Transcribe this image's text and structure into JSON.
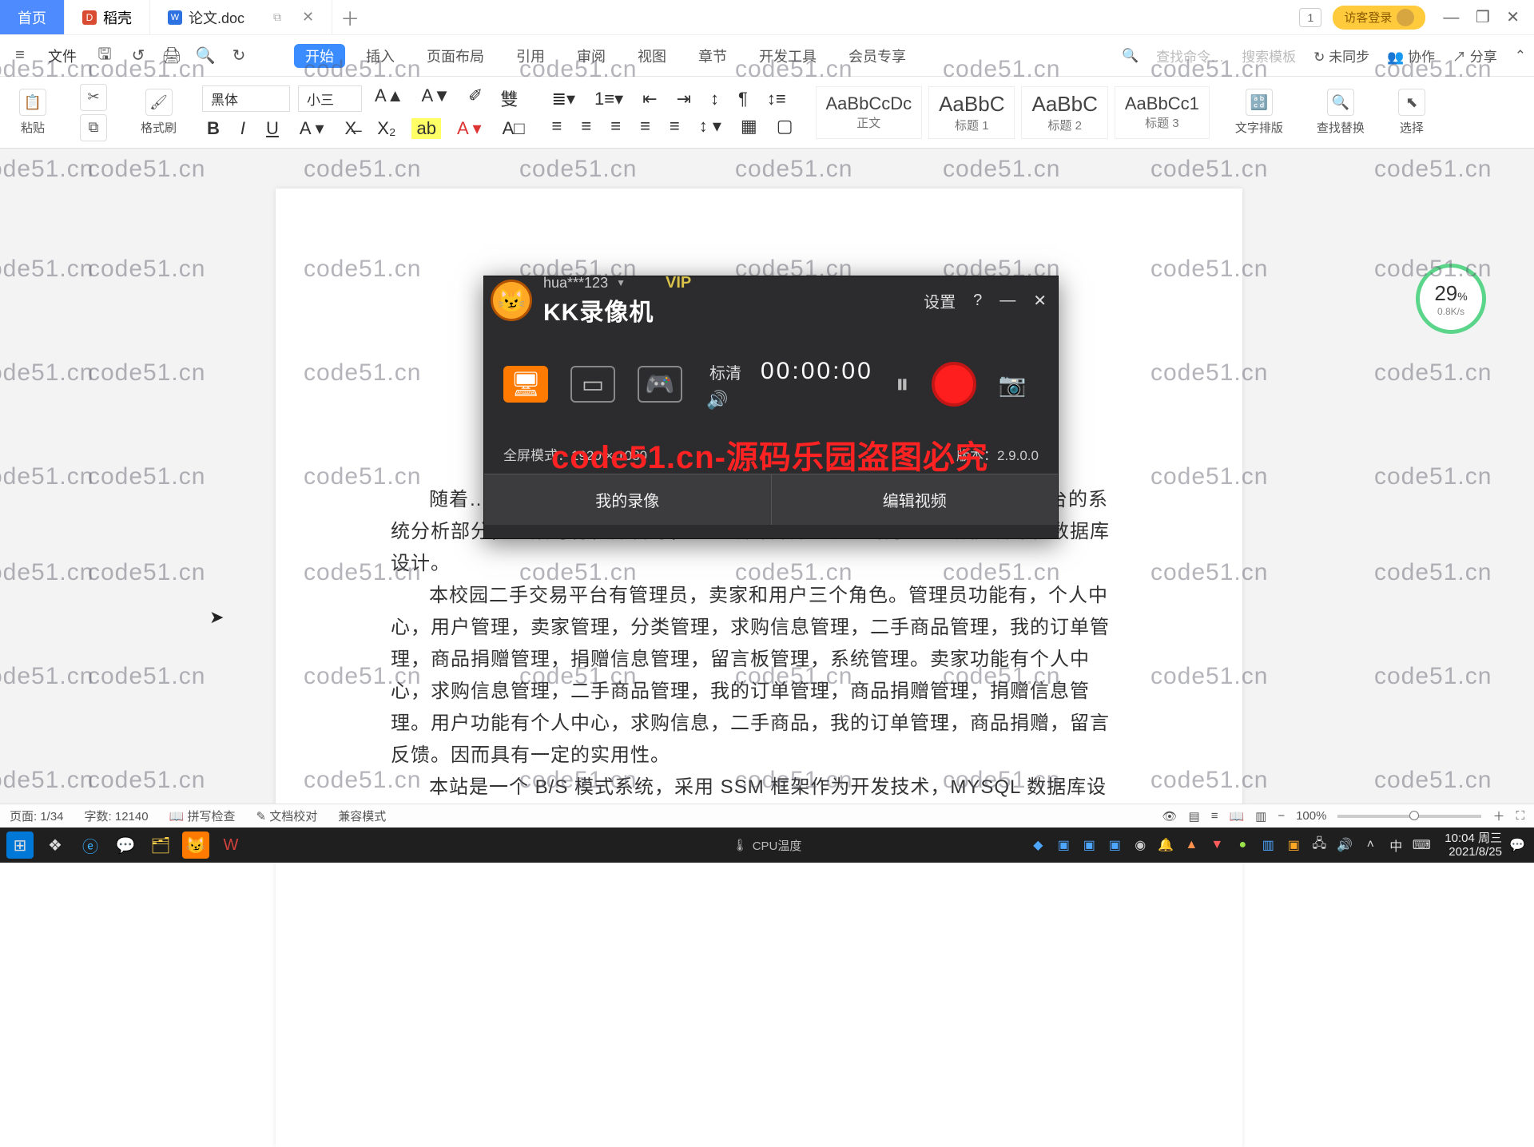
{
  "watermark_text": "code51.cn",
  "overlay_text": "code51.cn-源码乐园盗图必究",
  "titlebar": {
    "tabs": [
      {
        "label": "首页",
        "kind": "home"
      },
      {
        "label": "稻壳",
        "kind": "d-doc"
      },
      {
        "label": "论文.doc",
        "kind": "w-doc",
        "active": true
      }
    ],
    "detach_icon": "⧉",
    "close_icon": "✕",
    "add_icon": "＋",
    "badge_text": "1",
    "login_label": "访客登录",
    "win_min": "—",
    "win_restore": "❐",
    "win_close": "✕"
  },
  "menu": {
    "hamburger": "≡",
    "file_label": "文件",
    "items": [
      "开始",
      "插入",
      "页面布局",
      "引用",
      "审阅",
      "视图",
      "章节",
      "开发工具",
      "会员专享"
    ],
    "active_index": 0,
    "search_cmd_placeholder": "查找命令…",
    "search_tpl_placeholder": "搜索模板",
    "sync_label": "未同步",
    "collab_label": "协作",
    "share_label": "分享"
  },
  "ribbon": {
    "paste_label": "粘贴",
    "format_painter_label": "格式刷",
    "font_name": "黑体",
    "font_size": "小三",
    "bold": "B",
    "italic": "I",
    "underline": "U",
    "styles": [
      {
        "sample": "AaBbCcDc",
        "name": "正文"
      },
      {
        "sample": "AaBbC",
        "name": "标题 1"
      },
      {
        "sample": "AaBbC",
        "name": "标题 2"
      },
      {
        "sample": "AaBbCc1",
        "name": "标题 3"
      }
    ],
    "group_textbox": "文字排版",
    "group_findreplace": "查找替换",
    "group_select": "选择"
  },
  "document": {
    "paragraphs": [
      "随着……以及购物管理系统……园二手交易平台的……校园二手交易平台的系统分析部分，包括可行性分析等，系统设计部分主要介绍了系统功能设计和数据库设计。",
      "本校园二手交易平台有管理员，卖家和用户三个角色。管理员功能有，个人中心，用户管理，卖家管理，分类管理，求购信息管理，二手商品管理，我的订单管理，商品捐赠管理，捐赠信息管理，留言板管理，系统管理。卖家功能有个人中心，求购信息管理，二手商品管理，我的订单管理，商品捐赠管理，捐赠信息管理。用户功能有个人中心，求购信息，二手商品，我的订单管理，商品捐赠，留言反馈。因而具有一定的实用性。",
      "本站是一个 B/S 模式系统，采用 SSM 框架作为开发技术，MYSQL 数据库设计开发。"
    ]
  },
  "perf": {
    "percent": "29",
    "percent_unit": "%",
    "speed": "0.8K/s"
  },
  "kk": {
    "logo_text": "KK录像机",
    "user_label": "hua***123",
    "vip_label": "VIP",
    "settings_label": "设置",
    "help_icon": "?",
    "min_icon": "—",
    "close_icon": "✕",
    "quality_label": "标清",
    "timer": "00:00:00",
    "mode_full_info": "全屏模式：1920 × 1080",
    "version_label": "版本：2.9.0.0",
    "my_recordings": "我的录像",
    "edit_video": "编辑视频"
  },
  "statusbar": {
    "page_label": "页面: 1/34",
    "word_label": "字数: 12140",
    "spellcheck_label": "拼写检查",
    "proofread_label": "文档校对",
    "compat_label": "兼容模式",
    "zoom_label": "100%"
  },
  "taskbar": {
    "cpu_label": "CPU温度",
    "ime_label": "中",
    "time": "10:04 周三",
    "date": "2021/8/25"
  }
}
